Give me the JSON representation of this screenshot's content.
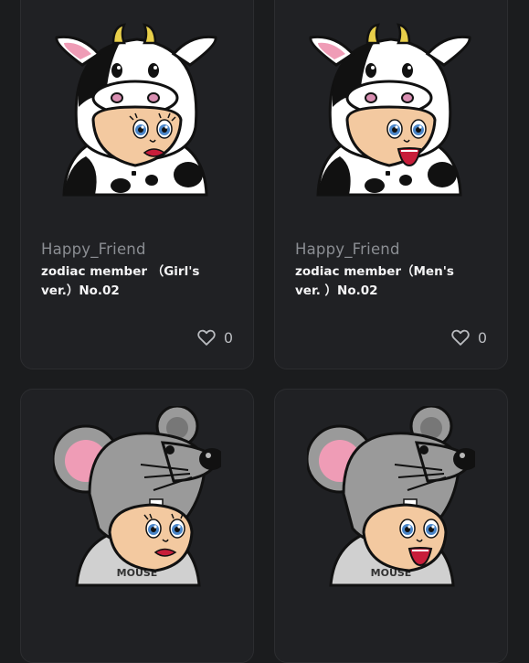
{
  "cards": [
    {
      "creator": "Happy_Friend",
      "title": "zodiac member （Girl's ver.）No.02",
      "like_count": "0",
      "icons": {
        "artwork": "cow-girl-avatar",
        "like": "heart-icon"
      }
    },
    {
      "creator": "Happy_Friend",
      "title": "zodiac member（Men's ver. ）No.02",
      "like_count": "0",
      "icons": {
        "artwork": "cow-boy-avatar",
        "like": "heart-icon"
      }
    },
    {
      "creator": "",
      "title": "",
      "like_count": "",
      "icons": {
        "artwork": "mouse-girl-avatar",
        "like": ""
      }
    },
    {
      "creator": "",
      "title": "",
      "like_count": "",
      "icons": {
        "artwork": "mouse-boy-avatar",
        "like": ""
      }
    }
  ],
  "colors": {
    "background": "#1b1c1e",
    "card": "#202124",
    "card_border": "#2c2d30",
    "creator_text": "#8b8e93",
    "title_text": "#f4f4f5"
  },
  "mouse_shirt_text": "MOUSE"
}
